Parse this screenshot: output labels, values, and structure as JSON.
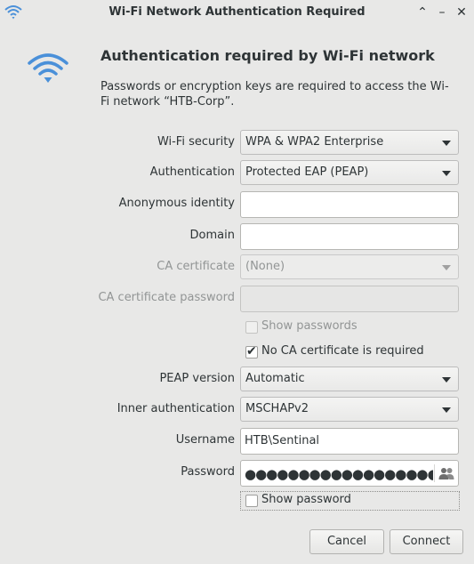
{
  "window": {
    "title": "Wi-Fi Network Authentication Required",
    "minimize_glyph": "–",
    "close_glyph": "✕",
    "collapse_glyph": "⌃"
  },
  "dialog": {
    "heading": "Authentication required by Wi-Fi network",
    "description": "Passwords or encryption keys are required to access the Wi-Fi network “HTB-Corp”.",
    "icon": "wifi-icon",
    "accent_color": "#4a90d9"
  },
  "form": {
    "wifi_security": {
      "label": "Wi-Fi security",
      "value": "WPA & WPA2 Enterprise"
    },
    "authentication": {
      "label": "Authentication",
      "value": "Protected EAP (PEAP)"
    },
    "anonymous_identity": {
      "label": "Anonymous identity",
      "value": ""
    },
    "domain": {
      "label": "Domain",
      "value": ""
    },
    "ca_certificate": {
      "label": "CA certificate",
      "value": "(None)"
    },
    "ca_certificate_password": {
      "label": "CA certificate password",
      "value": ""
    },
    "show_passwords": {
      "label": "Show passwords",
      "checked": false
    },
    "no_ca_required": {
      "label": "No CA certificate is required",
      "checked": true
    },
    "peap_version": {
      "label": "PEAP version",
      "value": "Automatic"
    },
    "inner_authentication": {
      "label": "Inner authentication",
      "value": "MSCHAPv2"
    },
    "username": {
      "label": "Username",
      "value": "HTB\\Sentinal"
    },
    "password": {
      "label": "Password",
      "value": "●●●●●●●●●●●●●●●●●●●●●●●"
    },
    "show_password": {
      "label": "Show password",
      "checked": false
    }
  },
  "buttons": {
    "cancel": "Cancel",
    "connect": "Connect"
  }
}
